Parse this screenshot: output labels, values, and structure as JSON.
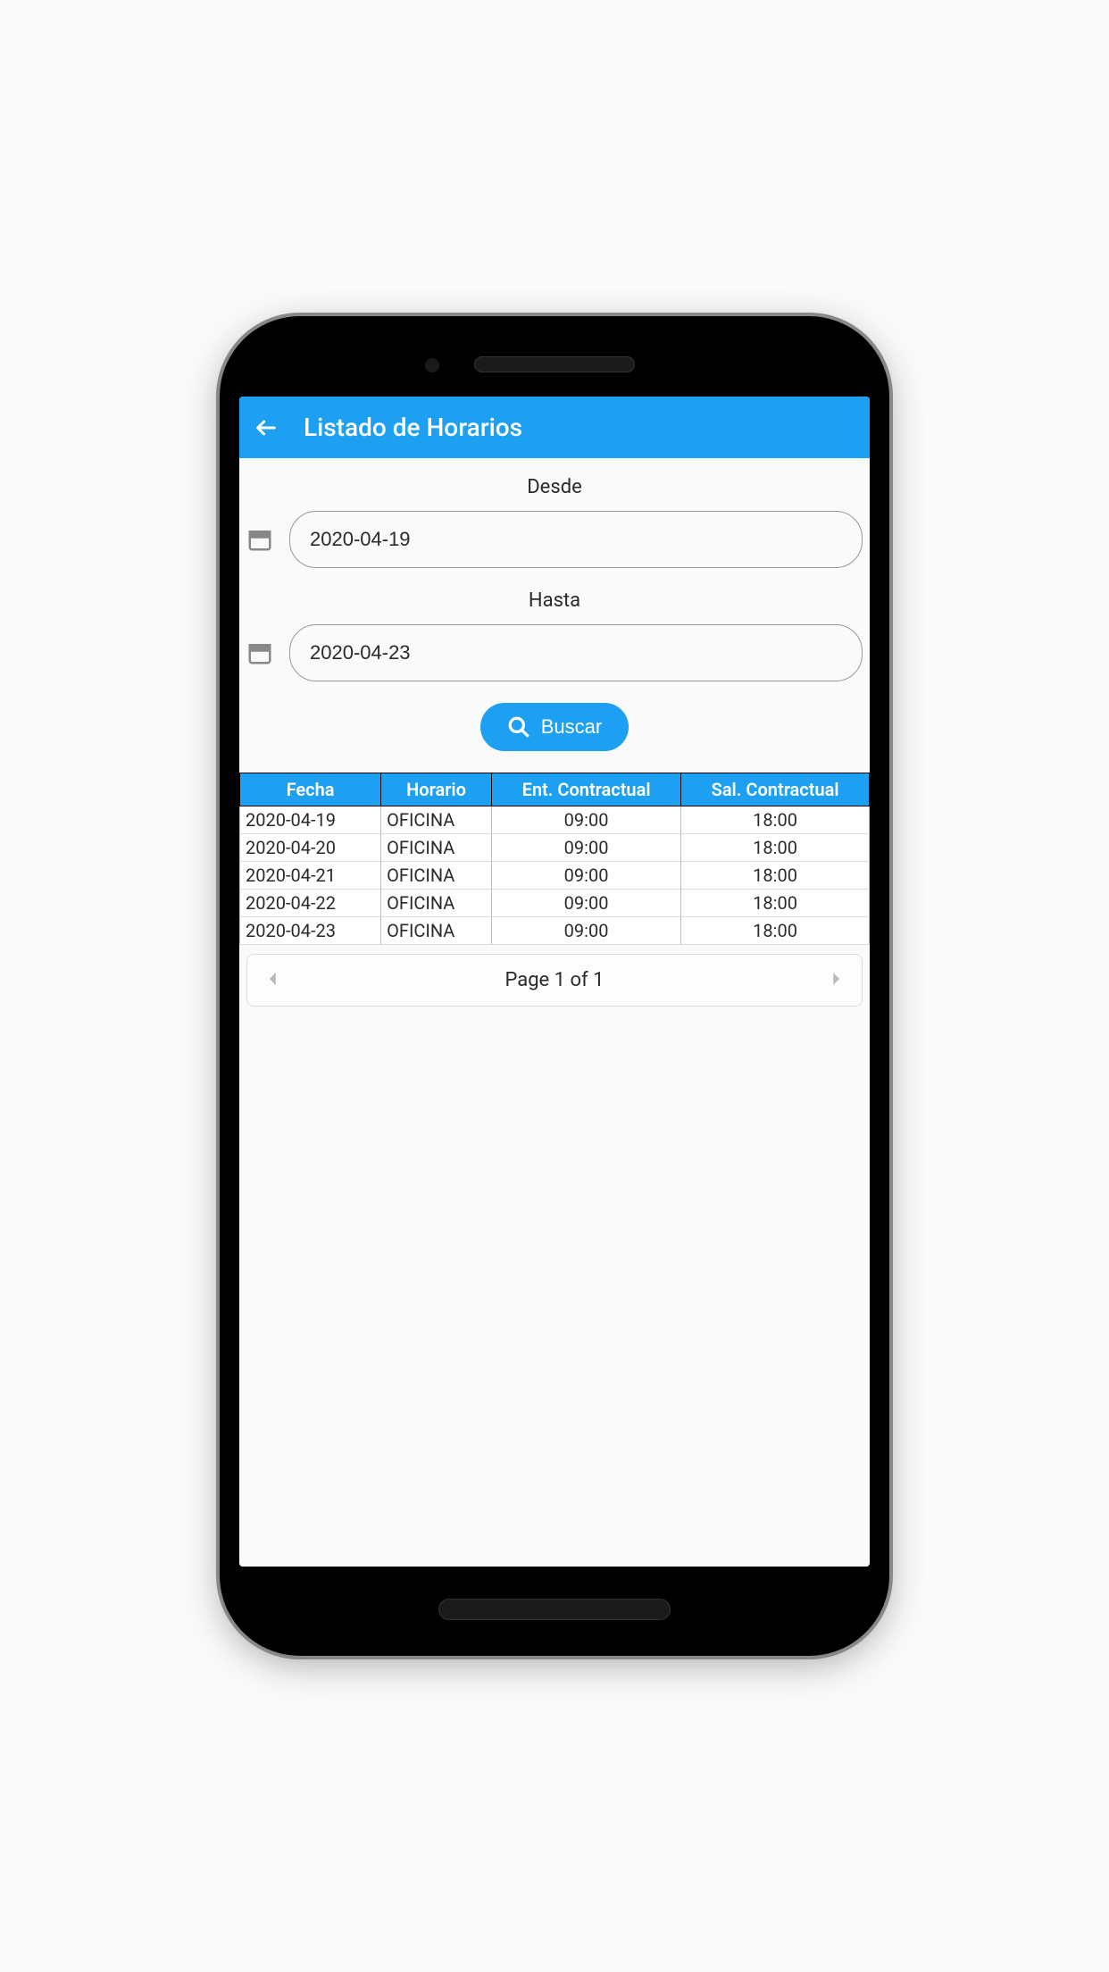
{
  "header": {
    "title": "Listado de Horarios"
  },
  "filters": {
    "from_label": "Desde",
    "from_value": "2020-04-19",
    "to_label": "Hasta",
    "to_value": "2020-04-23",
    "search_label": "Buscar"
  },
  "table": {
    "headers": [
      "Fecha",
      "Horario",
      "Ent. Contractual",
      "Sal. Contractual"
    ],
    "rows": [
      {
        "fecha": "2020-04-19",
        "horario": "OFICINA",
        "ent": "09:00",
        "sal": "18:00"
      },
      {
        "fecha": "2020-04-20",
        "horario": "OFICINA",
        "ent": "09:00",
        "sal": "18:00"
      },
      {
        "fecha": "2020-04-21",
        "horario": "OFICINA",
        "ent": "09:00",
        "sal": "18:00"
      },
      {
        "fecha": "2020-04-22",
        "horario": "OFICINA",
        "ent": "09:00",
        "sal": "18:00"
      },
      {
        "fecha": "2020-04-23",
        "horario": "OFICINA",
        "ent": "09:00",
        "sal": "18:00"
      }
    ]
  },
  "pager": {
    "text": "Page 1 of 1"
  }
}
